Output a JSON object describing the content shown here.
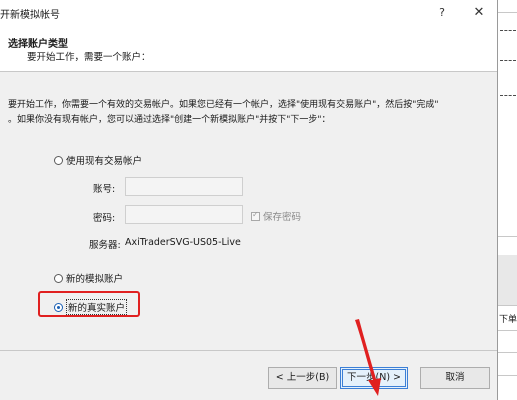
{
  "dialog": {
    "title": "开新模拟帐号",
    "help_symbol": "?",
    "close_symbol": "✕"
  },
  "header": {
    "title": "选择账户类型",
    "subtitle": "要开始工作，需要一个账户："
  },
  "description": {
    "line1": "要开始工作，你需要一个有效的交易帐户。如果您已经有一个帐户，选择\"使用现有交易账户\"，然后按\"完成\"",
    "line2": "。如果你没有现有帐户，您可以通过选择\"创建一个新模拟账户\"并按下\"下一步\"："
  },
  "options": {
    "existing": "使用现有交易帐户",
    "new_demo": "新的模拟账户",
    "new_real": "新的真实账户",
    "selected": "new_real"
  },
  "form": {
    "account_label": "账号:",
    "account_value": "",
    "password_label": "密码:",
    "password_value": "",
    "save_password_label": "保存密码",
    "server_label": "服务器:",
    "server_value": "AxiTraderSVG-US05-Live"
  },
  "buttons": {
    "back": "< 上一步(B)",
    "next": "下一步(N) >",
    "cancel": "取消"
  },
  "background": {
    "partial_text": "下单"
  },
  "colors": {
    "highlight": "#e02020",
    "accent": "#1a5fb4"
  }
}
